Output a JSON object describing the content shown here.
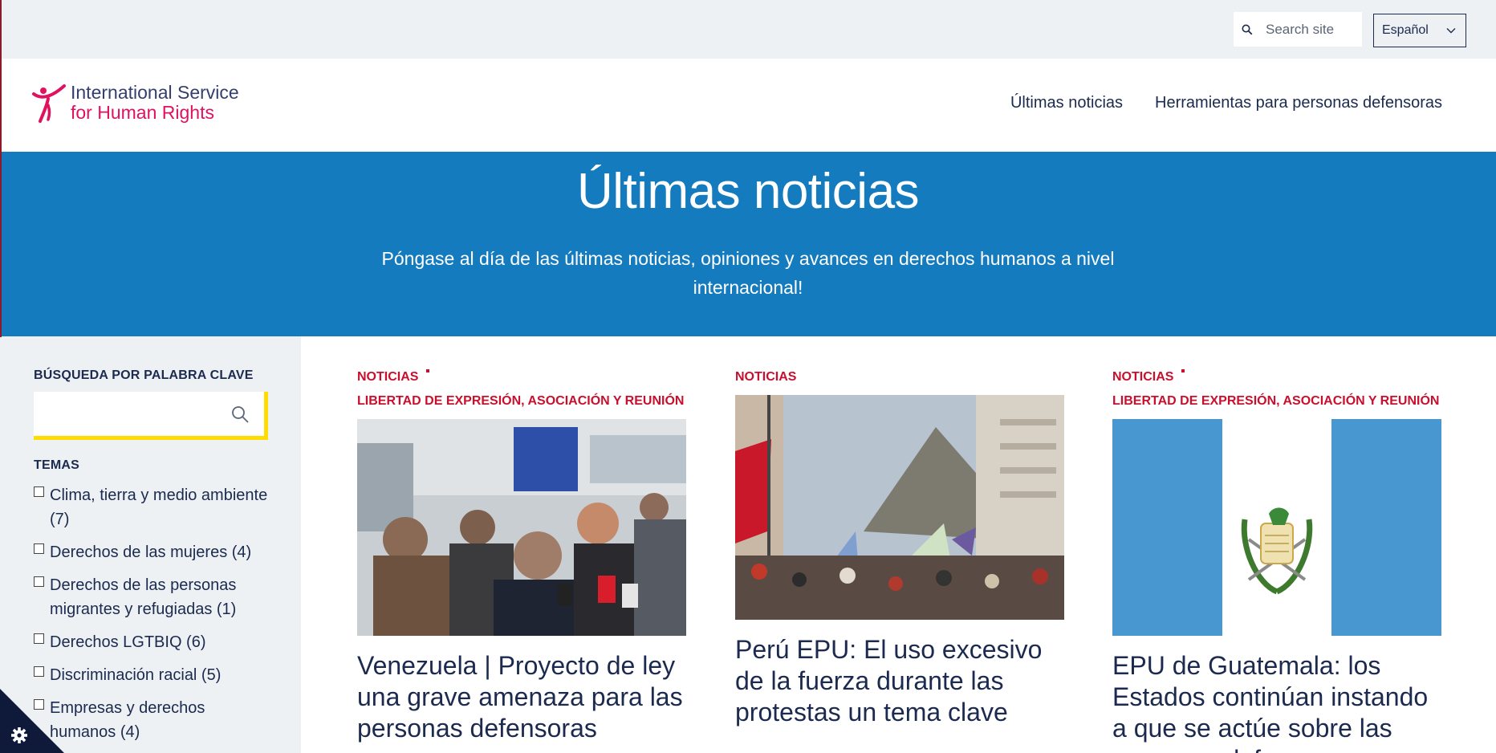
{
  "utility": {
    "search_placeholder": "Search site",
    "language": "Español"
  },
  "brand": {
    "line1": "International Service",
    "line2": "for Human Rights",
    "colors": {
      "navy": "#34406b",
      "magenta": "#e0115f"
    }
  },
  "nav": {
    "items": [
      {
        "label": "Últimas noticias"
      },
      {
        "label": "Herramientas para personas defensoras"
      }
    ]
  },
  "hero": {
    "title": "Últimas noticias",
    "subtitle": "Póngase al día de las últimas noticias, opiniones y avances en derechos humanos a nivel internacional!",
    "background": "#137bbe"
  },
  "sidebar": {
    "keyword_heading": "BÚSQUEDA POR PALABRA CLAVE",
    "keyword_value": "",
    "topics_heading": "TEMAS",
    "topics": [
      {
        "label": "Clima, tierra y medio ambiente (7)",
        "checked": false
      },
      {
        "label": "Derechos de las mujeres (4)",
        "checked": false
      },
      {
        "label": "Derechos de las personas migrantes y refugiadas (1)",
        "checked": false
      },
      {
        "label": "Derechos LGTBIQ (6)",
        "checked": false
      },
      {
        "label": "Discriminación racial (5)",
        "checked": false
      },
      {
        "label": "Empresas y derechos humanos (4)",
        "checked": false
      }
    ]
  },
  "articles": [
    {
      "category": "NOTICIAS",
      "subcategory": "LIBERTAD DE EXPRESIÓN, ASOCIACIÓN Y REUNIÓN",
      "image": "press-conference-photo",
      "title": "Venezuela | Proyecto de ley una grave amenaza para las personas defensoras"
    },
    {
      "category": "NOTICIAS",
      "subcategory": "",
      "image": "street-protest-photo",
      "title": "Perú EPU: El uso excesivo de la fuerza durante las protestas un tema clave"
    },
    {
      "category": "NOTICIAS",
      "subcategory": "LIBERTAD DE EXPRESIÓN, ASOCIACIÓN Y REUNIÓN",
      "image": "guatemala-flag",
      "title": "EPU de Guatemala: los Estados continúan instando a que se actúe sobre las personas defensoras"
    }
  ],
  "accent_colors": {
    "tag_red": "#c8102e",
    "focus_yellow": "#ffdd00",
    "text_navy": "#1b2a4e"
  }
}
